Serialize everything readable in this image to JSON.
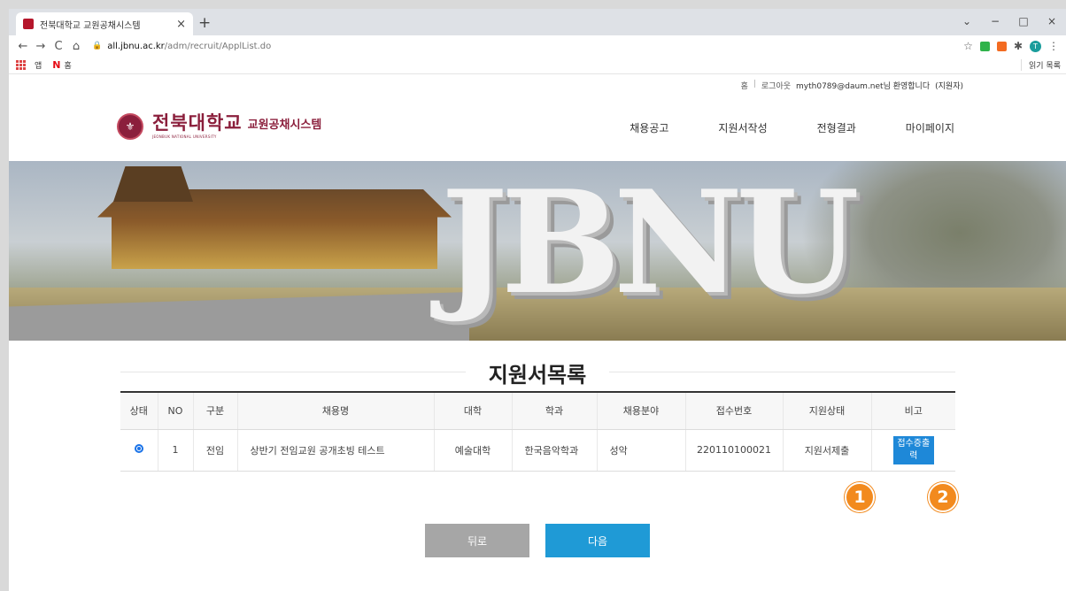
{
  "browser": {
    "tab_title": "전북대학교 교원공채시스템",
    "tab_close": "×",
    "new_tab": "+",
    "url_host": "all.jbnu.ac.kr",
    "url_path": "/adm/recruit/ApplList.do",
    "nav": {
      "back": "←",
      "forward": "→",
      "reload": "C",
      "home": "⌂"
    },
    "window_controls": {
      "dropdown": "⌄",
      "minimize": "−",
      "maximize": "□",
      "close": "×"
    },
    "avatar_letter": "T",
    "bookmarks": [
      {
        "label": "앱"
      },
      {
        "label": "홈",
        "icon": "N"
      }
    ],
    "reading_list": "읽기 목록"
  },
  "site": {
    "utility": {
      "home": "홈",
      "separator": "|",
      "logout": "로그아웃",
      "welcome": "myth0789@daum.net님 환영합니다",
      "role": "(지원자)"
    },
    "logo": {
      "main": "전북대학교",
      "eng": "JEONBUK NATIONAL UNIVERSITY",
      "sub": "교원공채시스템"
    },
    "nav": [
      "채용공고",
      "지원서작성",
      "전형결과",
      "마이페이지"
    ],
    "banner_text": "JBNU",
    "page_title": "지원서목록",
    "table": {
      "headers": [
        "상태",
        "NO",
        "구분",
        "채용명",
        "대학",
        "학과",
        "채용분야",
        "접수번호",
        "지원상태",
        "비고"
      ],
      "rows": [
        {
          "no": "1",
          "type": "전임",
          "title": "상반기 전임교원 공개초빙 테스트",
          "college": "예술대학",
          "department": "한국음악학과",
          "field": "성악",
          "receipt_no": "220110100021",
          "status": "지원서제출",
          "note_button": "접수증출력"
        }
      ]
    },
    "markers": [
      "1",
      "2"
    ],
    "buttons": {
      "back": "뒤로",
      "next": "다음"
    }
  },
  "colors": {
    "brand": "#8b1f3c",
    "primary_button": "#1f9ad6",
    "secondary_button": "#a6a6a6",
    "marker": "#f28a1e"
  }
}
